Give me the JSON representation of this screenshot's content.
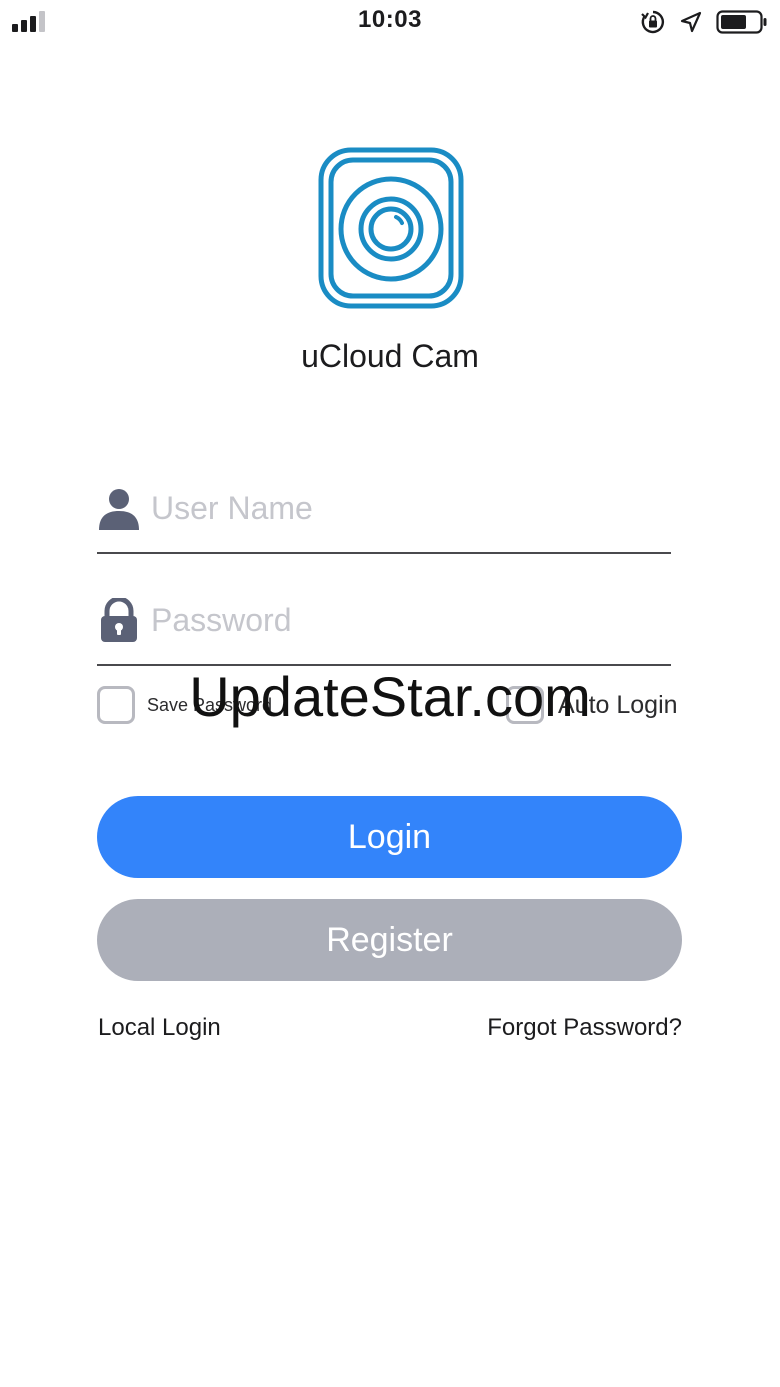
{
  "status_bar": {
    "time": "10:03",
    "icons": [
      "signal-icon",
      "orientation-lock-icon",
      "location-arrow-icon",
      "battery-icon"
    ]
  },
  "app": {
    "name": "uCloud Cam",
    "logo_color": "#1a8cc4"
  },
  "form": {
    "username_placeholder": "User Name",
    "password_placeholder": "Password",
    "save_password_label": "Save Password",
    "auto_login_label": "Auto Login",
    "icon_color": "#5b6176"
  },
  "buttons": {
    "login_label": "Login",
    "register_label": "Register",
    "login_color": "#3384fa",
    "register_color": "#acafb9"
  },
  "links": {
    "local_login": "Local Login",
    "forgot_password": "Forgot Password?"
  },
  "watermark": "UpdateStar.com"
}
